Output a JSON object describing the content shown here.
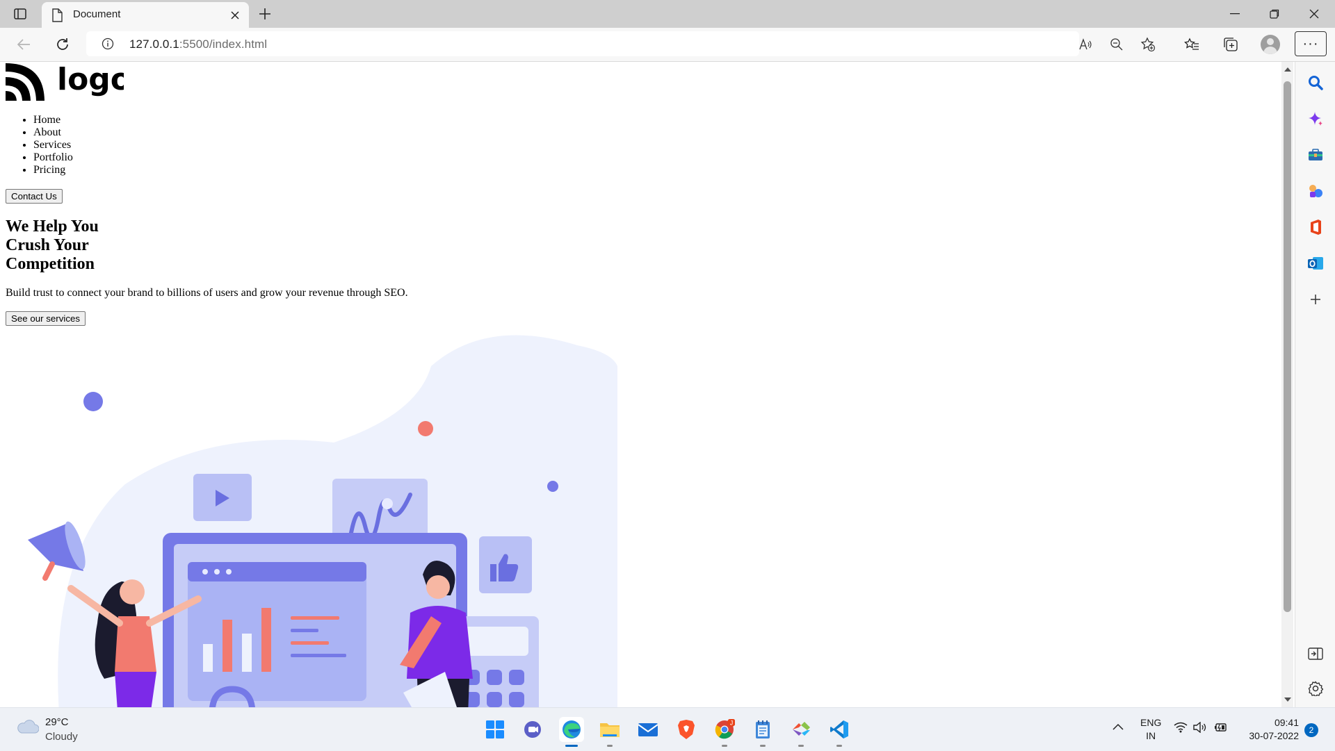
{
  "browser": {
    "tab_title": "Document",
    "url_host": "127.0.0.1",
    "url_path": ":5500/index.html",
    "more_label": "···"
  },
  "page": {
    "logo_text": "logo",
    "nav": [
      "Home",
      "About",
      "Services",
      "Portfolio",
      "Pricing"
    ],
    "contact_button": "Contact Us",
    "hero_title": "We Help You Crush Your Competition",
    "hero_subtitle": "Build trust to connect your brand to billions of users and grow your revenue through SEO.",
    "services_button": "See our services"
  },
  "sidebar_icons": [
    "search-icon",
    "copilot-icon",
    "tools-icon",
    "games-icon",
    "office-icon",
    "outlook-icon",
    "add-icon",
    "split-screen-icon",
    "settings-icon"
  ],
  "taskbar": {
    "weather_temp": "29°C",
    "weather_condition": "Cloudy",
    "apps": [
      "start-icon",
      "meet-icon",
      "edge-icon",
      "file-explorer-icon",
      "mail-icon",
      "brave-icon",
      "chrome-icon",
      "notepad-icon",
      "git-icon",
      "vscode-icon"
    ],
    "chrome_badge": "J",
    "lang_line1": "ENG",
    "lang_line2": "IN",
    "time": "09:41",
    "date": "30-07-2022",
    "notification_count": "2"
  },
  "colors": {
    "accent": "#0067c0",
    "illustration_primary": "#7579e7",
    "illustration_light": "#c6ccf7",
    "illustration_bg": "#eef2fd",
    "illustration_coral": "#f27a6f",
    "illustration_purple": "#7c2ae8"
  }
}
